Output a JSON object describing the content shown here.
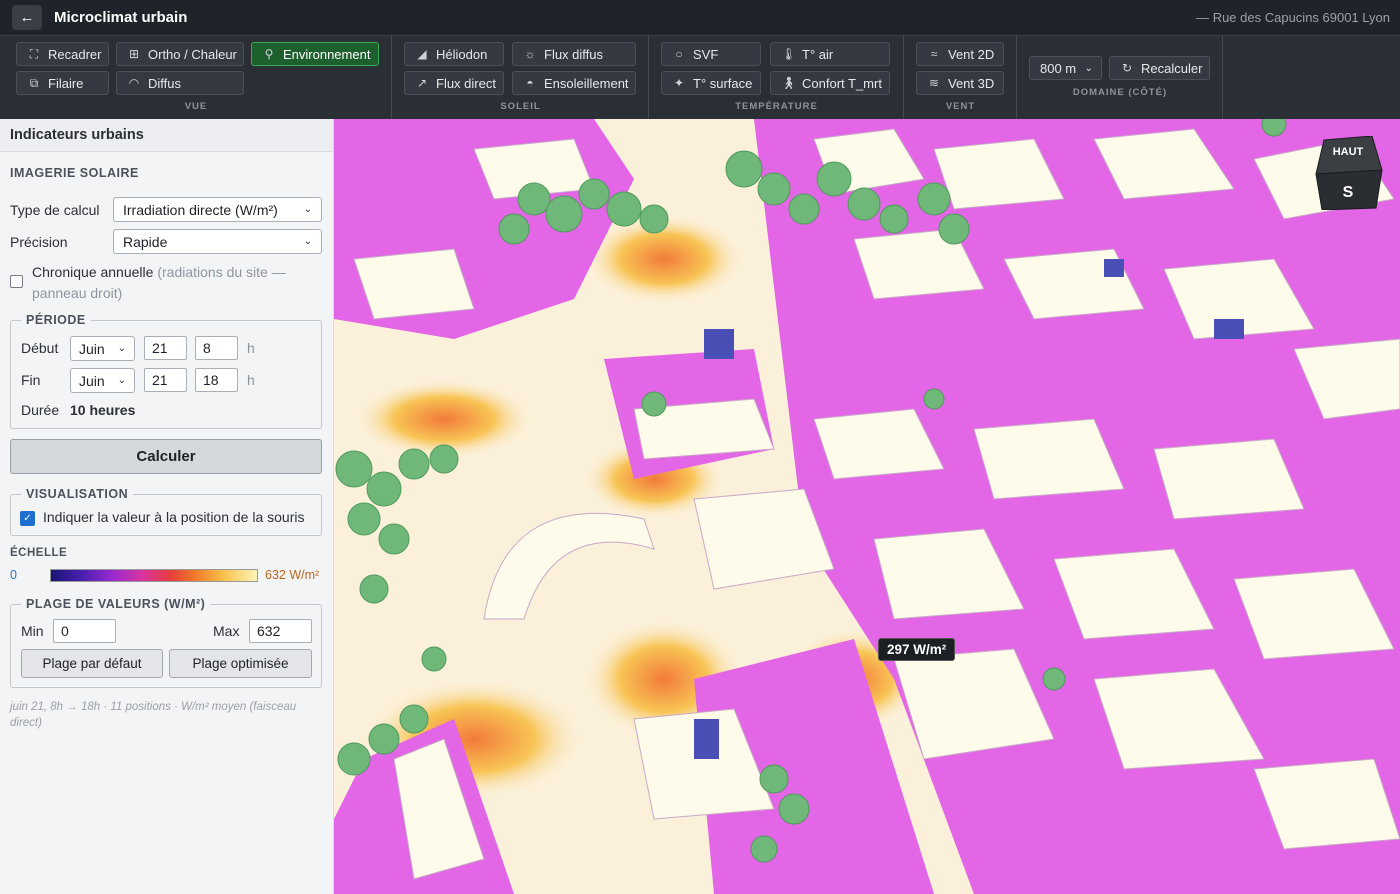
{
  "header": {
    "back_icon": "arrow-left-icon",
    "title": "Microclimat urbain",
    "address": "— Rue des Capucins 69001 Lyon"
  },
  "toolbar": {
    "vue": {
      "label": "VUE",
      "buttons": [
        {
          "label": "Recadrer",
          "icon": "crop-icon"
        },
        {
          "label": "Ortho / Chaleur",
          "icon": "grid-icon"
        },
        {
          "label": "Environnement",
          "icon": "pin-icon",
          "active": true
        },
        {
          "label": "Filaire",
          "icon": "wireframe-icon"
        },
        {
          "label": "Diffus",
          "icon": "dome-icon"
        }
      ]
    },
    "soleil": {
      "label": "SOLEIL",
      "buttons": [
        {
          "label": "Héliodon",
          "icon": "heliodon-icon"
        },
        {
          "label": "Flux diffus",
          "icon": "sun-icon"
        },
        {
          "label": "Flux direct",
          "icon": "ray-icon"
        },
        {
          "label": "Ensoleillement",
          "icon": "sunrise-icon"
        }
      ]
    },
    "temperature": {
      "label": "TEMPÉRATURE",
      "buttons": [
        {
          "label": "SVF",
          "icon": "circle-icon"
        },
        {
          "label": "T° air",
          "icon": "thermometer-icon"
        },
        {
          "label": "T° surface",
          "icon": "sparkle-icon"
        },
        {
          "label": "Confort T_mrt",
          "icon": "person-icon"
        }
      ]
    },
    "vent": {
      "label": "VENT",
      "buttons": [
        {
          "label": "Vent 2D",
          "icon": "wind-icon"
        },
        {
          "label": "Vent 3D",
          "icon": "wind3d-icon"
        }
      ]
    },
    "domaine": {
      "label": "DOMAINE (CÔTÉ)",
      "size": "800 m",
      "recalc": "Recalculer",
      "recalc_icon": "refresh-icon"
    }
  },
  "sidebar": {
    "title": "Indicateurs urbains",
    "imagerie_title": "IMAGERIE SOLAIRE",
    "type_label": "Type de calcul",
    "type_value": "Irradiation directe (W/m²)",
    "precision_label": "Précision",
    "precision_value": "Rapide",
    "chronique_label": "Chronique annuelle",
    "chronique_note": "(radiations du site — panneau droit)",
    "periode": {
      "title": "PÉRIODE",
      "debut_label": "Début",
      "debut_month": "Juin",
      "debut_day": "21",
      "debut_hour": "8",
      "fin_label": "Fin",
      "fin_month": "Juin",
      "fin_day": "21",
      "fin_hour": "18",
      "unit_h": "h",
      "duree_label": "Durée",
      "duree_value": "10 heures"
    },
    "calculer": "Calculer",
    "visualisation": {
      "title": "VISUALISATION",
      "checkbox_label": "Indiquer la valeur à la position de la souris",
      "checked": true
    },
    "echelle": {
      "title": "ÉCHELLE",
      "min": "0",
      "max": "632 W/m²"
    },
    "plage": {
      "title": "PLAGE DE VALEURS (W/M²)",
      "min_label": "Min",
      "min_value": "0",
      "max_label": "Max",
      "max_value": "632",
      "default_btn": "Plage par défaut",
      "optimized_btn": "Plage optimisée"
    },
    "footnote": "juin 21, 8h → 18h · 11 positions · W/m² moyen (faisceau direct)"
  },
  "map": {
    "tooltip": "297 W/m²",
    "navcube_top": "HAUT",
    "navcube_face": "S"
  }
}
